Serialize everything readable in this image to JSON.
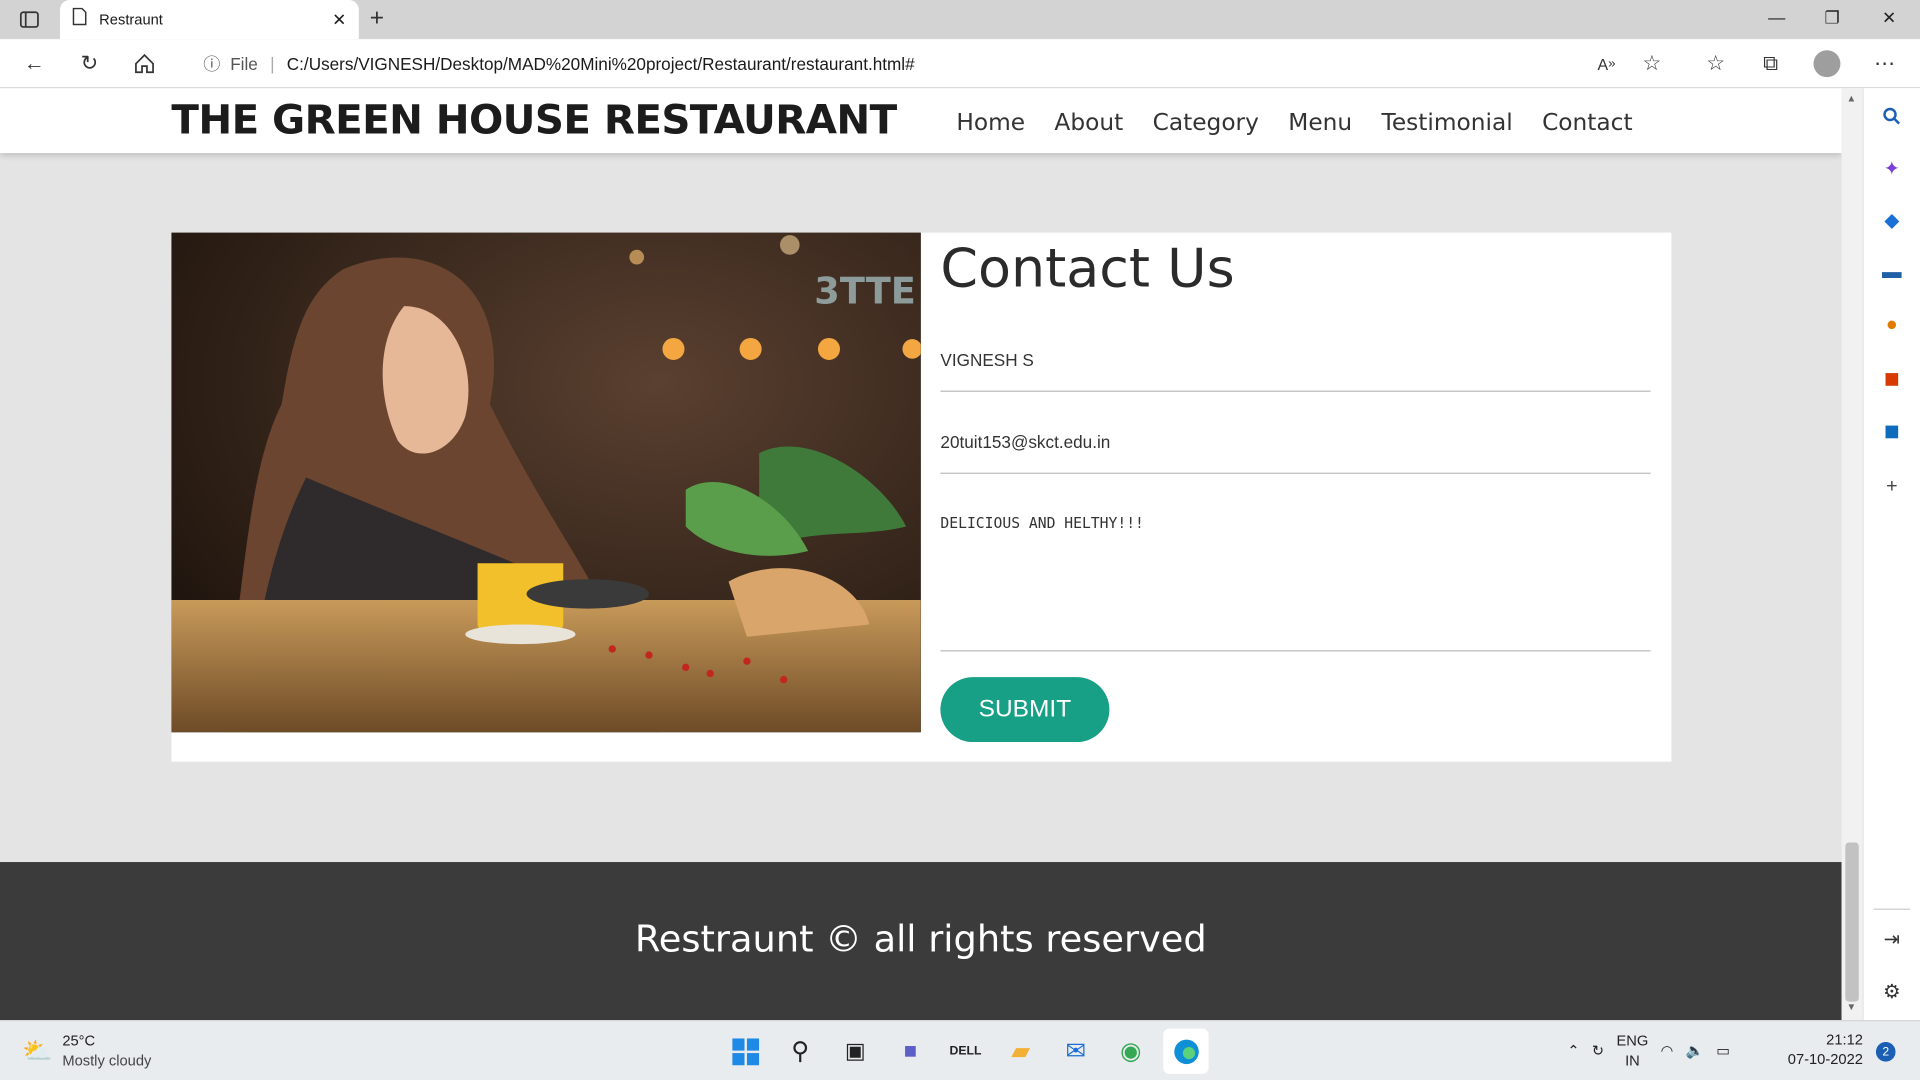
{
  "browser": {
    "tab_title": "Restraunt",
    "address_scheme_label": "File",
    "url": "C:/Users/VIGNESH/Desktop/MAD%20Mini%20project/Restaurant/restaurant.html#"
  },
  "site": {
    "brand": "THE GREEN HOUSE RESTAURANT",
    "nav": [
      "Home",
      "About",
      "Category",
      "Menu",
      "Testimonial",
      "Contact"
    ]
  },
  "contact": {
    "heading": "Contact Us",
    "name_value": "VIGNESH S",
    "email_value": "20tuit153@skct.edu.in",
    "message_value": "DELICIOUS AND HELTHY!!!",
    "submit_label": "SUBMIT"
  },
  "footer": {
    "text": "Restraunt © all rights reserved"
  },
  "taskbar": {
    "temperature": "25°C",
    "weather": "Mostly cloudy",
    "lang_top": "ENG",
    "lang_bottom": "IN",
    "time": "21:12",
    "date": "07-10-2022",
    "notification_count": "2"
  },
  "colors": {
    "accent": "#17a085",
    "footer_bg": "#3b3b3b"
  }
}
